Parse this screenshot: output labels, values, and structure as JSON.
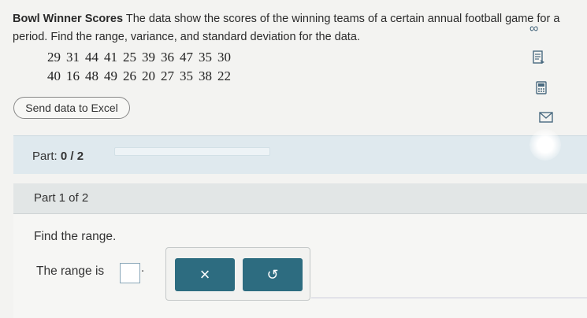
{
  "problem": {
    "title": "Bowl Winner Scores",
    "text": "The data show the scores of the winning teams of a certain annual football game for a period. Find the range, variance, and standard deviation for the data."
  },
  "data": {
    "row1": [
      "29",
      "31",
      "44",
      "41",
      "25",
      "39",
      "36",
      "47",
      "35",
      "30"
    ],
    "row2": [
      "40",
      "16",
      "48",
      "49",
      "26",
      "20",
      "27",
      "35",
      "38",
      "22"
    ]
  },
  "icons": {
    "link": "infinity-icon",
    "notes": "notes-icon",
    "calculator": "calculator-icon",
    "message": "message-icon"
  },
  "buttons": {
    "excel": "Send data to Excel",
    "clear": "×",
    "undo": "↺"
  },
  "part_bar": {
    "label": "Part:",
    "progress": "0 / 2",
    "progress_fraction": 0
  },
  "part1": {
    "label": "Part 1 of 2"
  },
  "question": {
    "prompt": "Find the range.",
    "answer_label": "The range is",
    "answer_value": "",
    "suffix": "."
  },
  "colors": {
    "accent": "#2d6c80",
    "part_bar": "#dfe9ee",
    "background": "#f3f3f1"
  }
}
